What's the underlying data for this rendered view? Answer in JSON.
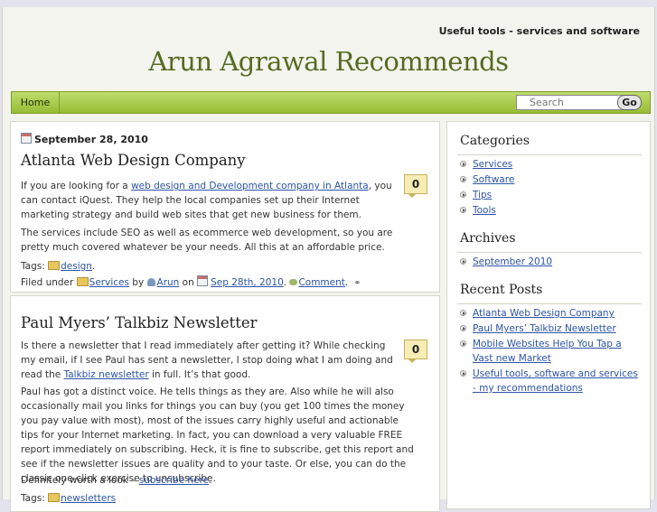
{
  "header": {
    "tagline": "Useful tools - services and software",
    "site_title": "Arun Agrawal Recommends"
  },
  "nav": {
    "home_label": "Home",
    "search_placeholder": "Search",
    "go_label": "Go"
  },
  "posts": [
    {
      "date": "September 28, 2010",
      "title": "Atlanta Web Design Company",
      "comment_count": "0",
      "p1": {
        "pre": "If you are looking for a ",
        "link": "web design and Development company in Atlanta",
        "post": ", you can contact iQuest. They help the local companies set up their Internet marketing strategy and build web sites that get new business for them."
      },
      "p2": "The services include SEO as well as ecommerce web development, so you are pretty much covered whatever be your needs. All this at an affordable price.",
      "tags_prefix": "Tags: ",
      "tag": "design",
      "filed_prefix": "Filed under ",
      "category": "Services",
      "by": " by ",
      "author": "Arun",
      "on": " on ",
      "date_link": "Sep 28th, 2010",
      "comment_link": "Comment"
    },
    {
      "title": "Paul Myers’ Talkbiz Newsletter",
      "comment_count": "0",
      "p1": {
        "pre": "Is there a newsletter that I read immediately after getting it? While checking my email, if I see Paul has sent a newsletter, I stop doing what I am doing and read the ",
        "link": "Talkbiz newsletter",
        "post": " in full. It’s that good."
      },
      "p2": "Paul has got a distinct voice. He tells things as they are. Also while he will also occasionally mail you links for things you can buy (you get 100 times the money you pay value with most), most of the issues carry highly useful and actionable tips for your Internet marketing. In fact, you can download a very valuable FREE report immediately on subscribing. Heck, it is fine to subscribe, get this report and see if the newsletter issues are quality and to your taste. Or else, you can do the classic one-click exercise to unsubscribe.",
      "p3": {
        "pre": "Definitely worth a look – ",
        "link": "subscribe here",
        "post": "."
      },
      "tags_prefix": "Tags: ",
      "tag": "newsletters"
    }
  ],
  "sidebar": {
    "categories_title": "Categories",
    "categories": [
      "Services",
      "Software",
      "Tips",
      "Tools"
    ],
    "archives_title": "Archives",
    "archives": [
      "September 2010"
    ],
    "recent_title": "Recent Posts",
    "recent": [
      "Atlanta Web Design Company",
      "Paul Myers’ Talkbiz Newsletter",
      "Mobile Websites Help You Tap a Vast new Market",
      "Useful tools, software and services - my recommendations"
    ]
  }
}
